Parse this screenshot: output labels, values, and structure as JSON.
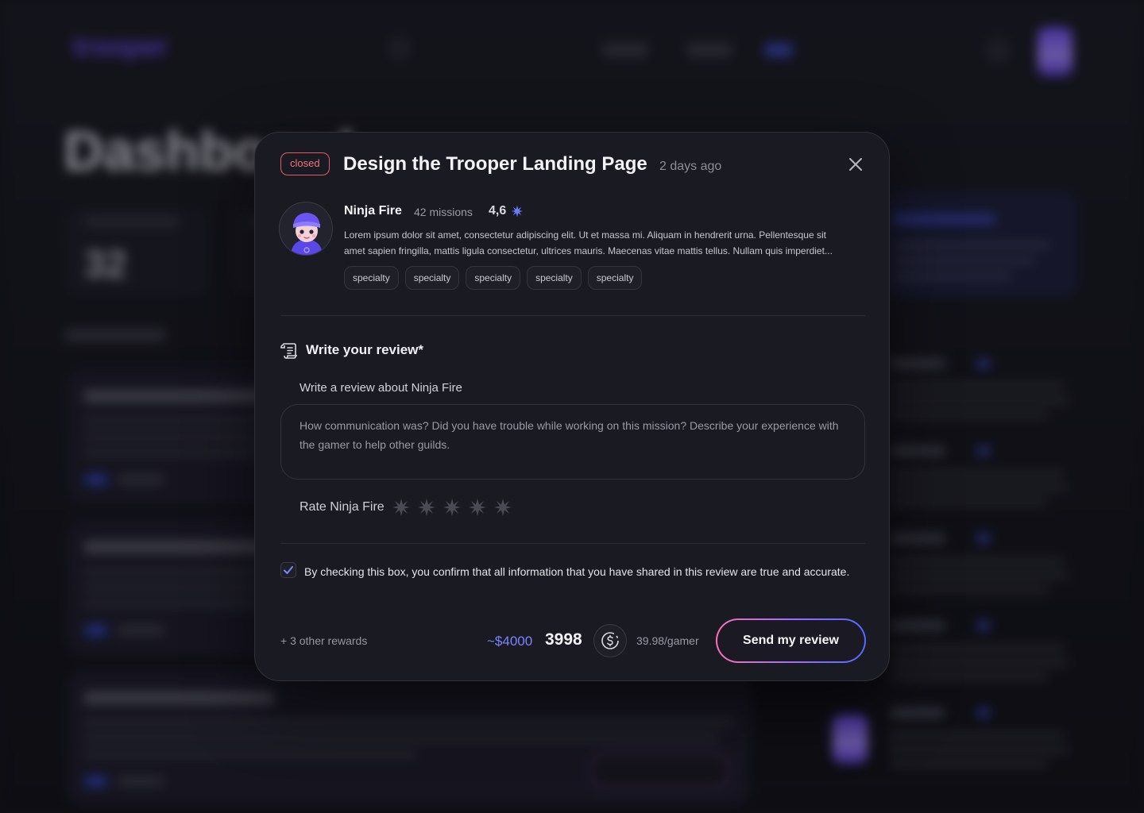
{
  "background": {
    "logo": "trooper",
    "page_title": "Dashboard",
    "stat_value": "32"
  },
  "modal": {
    "status": "closed",
    "title": "Design the Trooper Landing Page",
    "time": "2 days ago",
    "close_icon": "close-icon",
    "author": {
      "name": "Ninja Fire",
      "missions": "42 missions",
      "rating": "4,6",
      "bio_line1": "Lorem ipsum dolor sit amet, consectetur adipiscing elit. Ut et massa mi. Aliquam in hendrerit urna. Pellentesque sit",
      "bio_line2": "amet sapien fringilla, mattis ligula consectetur, ultrices mauris. Maecenas vitae mattis tellus. Nullam quis imperdiet...",
      "tags": [
        "specialty",
        "specialty",
        "specialty",
        "specialty",
        "specialty"
      ]
    },
    "review": {
      "section_title": "Write your review*",
      "field_label": "Write a review about Ninja Fire",
      "placeholder": "How communication was? Did you have trouble while working on this mission? Describe your experience with the gamer to help other guilds.",
      "value": "",
      "rate_label": "Rate Ninja Fire",
      "stars_selected": 0,
      "stars_total": 5
    },
    "confirm": {
      "checked": true,
      "text": "By checking this box, you confirm that all information that you have shared in this review are true and accurate."
    },
    "footer": {
      "other_rewards": "+ 3 other rewards",
      "reward_usd": "~$4000",
      "reward_amount": "3998",
      "per_gamer": "39.98/gamer",
      "send_label": "Send my review"
    }
  },
  "colors": {
    "accent": "#7b85ff",
    "status_closed": "#e35b63",
    "star_idle": "#4a4a55",
    "rating_star": "#6b7bff"
  }
}
